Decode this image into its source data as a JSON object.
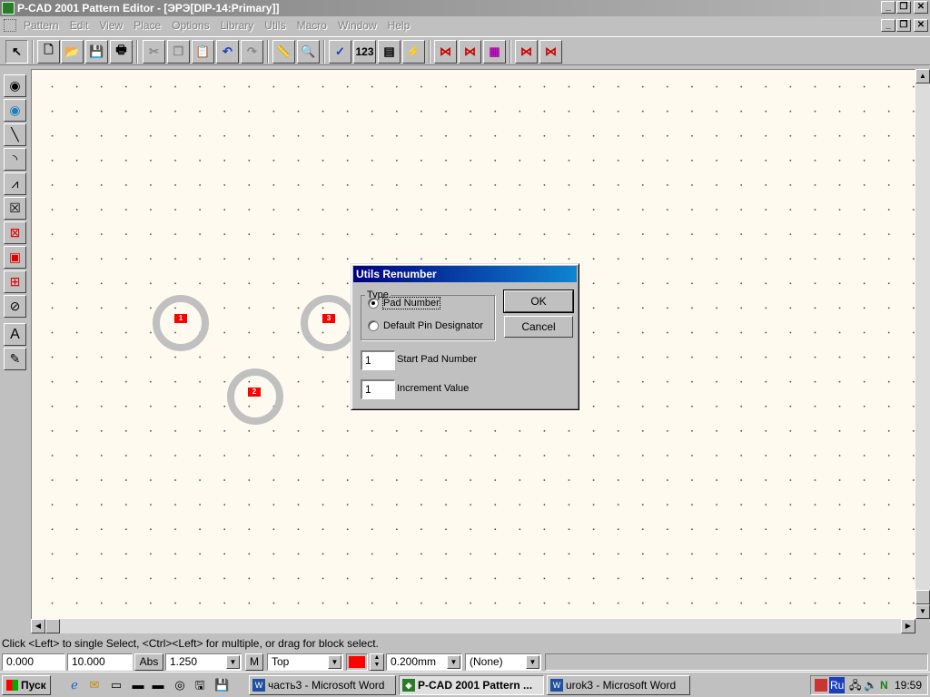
{
  "window": {
    "title": "P-CAD 2001 Pattern Editor - [ЭРЭ[DIP-14:Primary]]"
  },
  "menu": {
    "items": [
      "Pattern",
      "Edit",
      "View",
      "Place",
      "Options",
      "Library",
      "Utils",
      "Macro",
      "Window",
      "Help"
    ]
  },
  "toolbar": {
    "buttons": [
      {
        "name": "select-tool-icon",
        "glyph": "↖"
      },
      {
        "name": "new-file-icon",
        "glyph": "🗋"
      },
      {
        "name": "open-folder-icon",
        "glyph": "📂"
      },
      {
        "name": "save-icon",
        "glyph": "💾"
      },
      {
        "name": "print-icon",
        "glyph": "🖶"
      },
      {
        "name": "cut-icon",
        "glyph": "✂"
      },
      {
        "name": "copy-icon",
        "glyph": "❐"
      },
      {
        "name": "paste-icon",
        "glyph": "📋"
      },
      {
        "name": "undo-icon",
        "glyph": "↶"
      },
      {
        "name": "redo-icon",
        "glyph": "↷"
      },
      {
        "name": "measure-icon",
        "glyph": "📏"
      },
      {
        "name": "zoom-icon",
        "glyph": "🔍"
      },
      {
        "name": "check-icon",
        "glyph": "✓"
      },
      {
        "name": "renumber-icon",
        "glyph": "123"
      },
      {
        "name": "properties-icon",
        "glyph": "▤"
      },
      {
        "name": "lightning-icon",
        "glyph": "⚡"
      },
      {
        "name": "pattern-tool-1-icon",
        "glyph": "⋈"
      },
      {
        "name": "pattern-tool-2-icon",
        "glyph": "⋈"
      },
      {
        "name": "pattern-tool-3-icon",
        "glyph": "▦"
      },
      {
        "name": "pattern-tool-4-icon",
        "glyph": "⋈"
      },
      {
        "name": "pattern-tool-5-icon",
        "glyph": "⋈"
      }
    ]
  },
  "palette": {
    "tools": [
      {
        "name": "place-pad-icon",
        "glyph": "◉"
      },
      {
        "name": "place-via-icon",
        "glyph": "◉"
      },
      {
        "name": "place-line-icon",
        "glyph": "╲"
      },
      {
        "name": "place-arc-icon",
        "glyph": "◝"
      },
      {
        "name": "place-polygon-icon",
        "glyph": "⩘"
      },
      {
        "name": "place-rectangle-icon",
        "glyph": "☒"
      },
      {
        "name": "place-copper-pour-icon",
        "glyph": "⊠"
      },
      {
        "name": "place-cutout-icon",
        "glyph": "▣"
      },
      {
        "name": "place-plane-icon",
        "glyph": "⊞"
      },
      {
        "name": "place-keepout-icon",
        "glyph": "⊘"
      },
      {
        "name": "place-text-icon",
        "glyph": "A"
      },
      {
        "name": "place-attribute-icon",
        "glyph": "✎"
      }
    ]
  },
  "pads": [
    {
      "label": "1"
    },
    {
      "label": "3"
    },
    {
      "label": "2"
    }
  ],
  "colors": {
    "pad_ring": "#c0c0c0",
    "pad_label_bg": "#ff0000",
    "workspace_bg": "#fffaf0",
    "dialog_title_bg": "#000080"
  },
  "dialog": {
    "title": "Utils Renumber",
    "type_group_label": "Type",
    "radio_pad_number": "Pad Number",
    "radio_default_pin": "Default Pin Designator",
    "selected_type": "Pad Number",
    "ok_label": "OK",
    "cancel_label": "Cancel",
    "start_value": "1",
    "start_label": "Start Pad Number",
    "increment_value": "1",
    "increment_label": "Increment Value"
  },
  "status": {
    "message": "Click <Left> to single Select, <Ctrl><Left> for multiple, or drag for block select."
  },
  "fields": {
    "x_coord": "0.000",
    "y_coord": "10.000",
    "abs_label": "Abs",
    "grid": "1.250",
    "m_label": "M",
    "layer": "Top",
    "line_width": "0.200mm",
    "none_option": "(None)",
    "layer_color": "#ff0000"
  },
  "taskbar": {
    "start_label": "Пуск",
    "tasks": [
      {
        "label": "часть3 - Microsoft Word",
        "active": false
      },
      {
        "label": "P-CAD 2001 Pattern ...",
        "active": true
      },
      {
        "label": "urok3 - Microsoft Word",
        "active": false
      }
    ],
    "tray_lang": "Ru",
    "clock": "19:59"
  }
}
